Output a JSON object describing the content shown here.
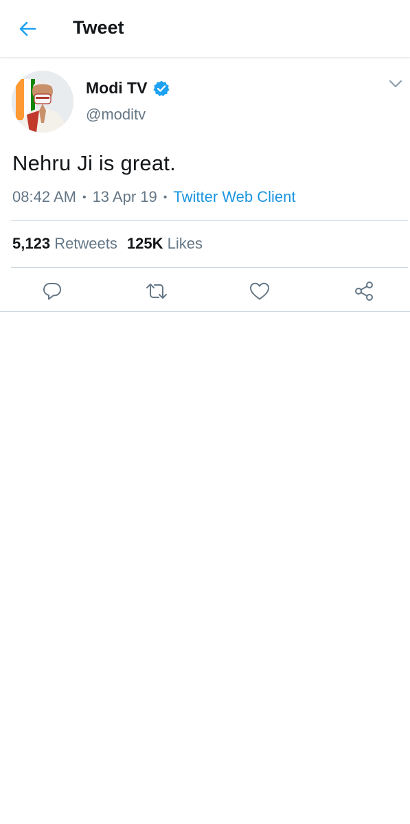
{
  "header": {
    "title": "Tweet",
    "back_icon": "arrow-left-icon"
  },
  "tweet": {
    "display_name": "Modi TV",
    "verified": true,
    "handle": "@moditv",
    "text": "Nehru Ji is great.",
    "time": "08:42 AM",
    "date": "13 Apr 19",
    "client": "Twitter Web Client",
    "retweets_count": "5,123",
    "retweets_label": "Retweets",
    "likes_count": "125K",
    "likes_label": "Likes"
  },
  "actions": [
    "reply-icon",
    "retweet-icon",
    "like-icon",
    "share-icon"
  ],
  "colors": {
    "accent": "#1da1f2",
    "link": "#1b95e0",
    "secondary_text": "#657786",
    "primary_text": "#14171a",
    "divider": "#ccd6dd"
  }
}
